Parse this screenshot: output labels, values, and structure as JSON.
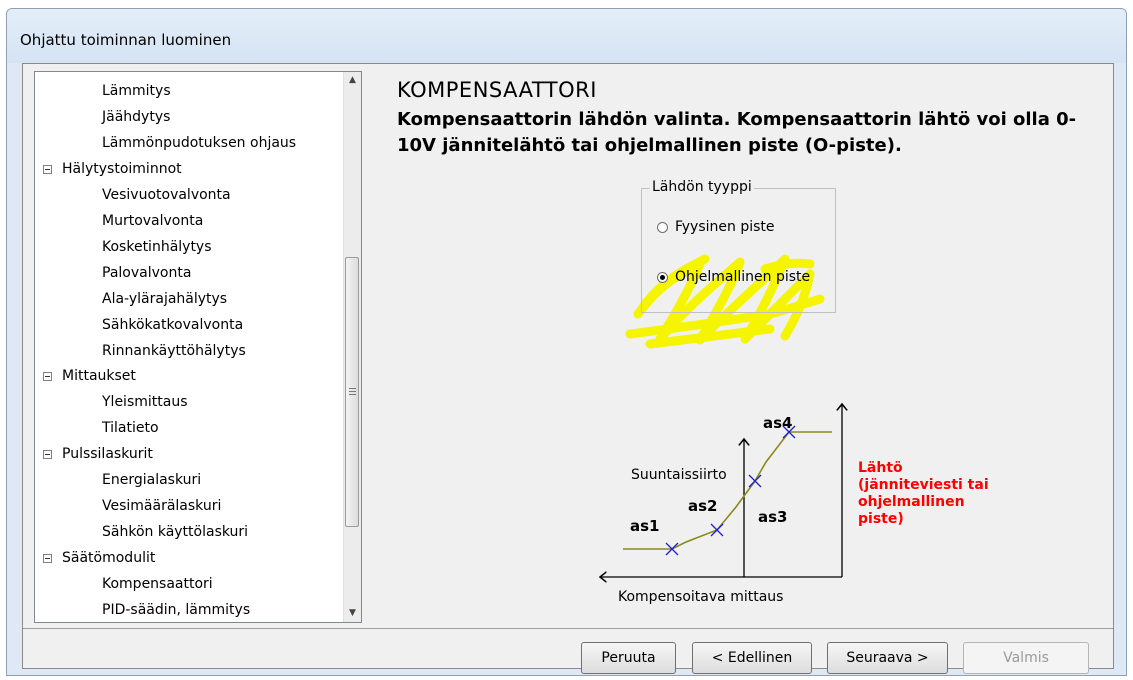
{
  "window": {
    "title": "Ohjattu toiminnan luominen"
  },
  "tree": {
    "items": [
      {
        "label": "Lämmitys",
        "level": 1
      },
      {
        "label": "Jäähdytys",
        "level": 1
      },
      {
        "label": "Lämmönpudotuksen ohjaus",
        "level": 1
      },
      {
        "label": "Hälytystoiminnot",
        "level": 0,
        "expanded": true
      },
      {
        "label": "Vesivuotovalvonta",
        "level": 1
      },
      {
        "label": "Murtovalvonta",
        "level": 1
      },
      {
        "label": "Kosketinhälytys",
        "level": 1
      },
      {
        "label": "Palovalvonta",
        "level": 1
      },
      {
        "label": "Ala-ylärajahälytys",
        "level": 1
      },
      {
        "label": "Sähkökatkovalvonta",
        "level": 1
      },
      {
        "label": "Rinnankäyttöhälytys",
        "level": 1
      },
      {
        "label": "Mittaukset",
        "level": 0,
        "expanded": true
      },
      {
        "label": "Yleismittaus",
        "level": 1
      },
      {
        "label": "Tilatieto",
        "level": 1
      },
      {
        "label": "Pulssilaskurit",
        "level": 0,
        "expanded": true
      },
      {
        "label": "Energialaskuri",
        "level": 1
      },
      {
        "label": "Vesimäärälaskuri",
        "level": 1
      },
      {
        "label": "Sähkön käyttölaskuri",
        "level": 1
      },
      {
        "label": "Säätömodulit",
        "level": 0,
        "expanded": true
      },
      {
        "label": "Kompensaattori",
        "level": 1
      },
      {
        "label": "PID-säädin, lämmitys",
        "level": 1
      }
    ]
  },
  "panel": {
    "title": "KOMPENSAATTORI",
    "description": "Kompensaattorin lähdön valinta. Kompensaattorin lähtö voi olla 0-10V jännitelähtö tai ohjelmallinen piste (O-piste).",
    "group": {
      "label": "Lähdön tyyppi",
      "options": [
        {
          "label": "Fyysinen piste",
          "selected": false
        },
        {
          "label": "Ohjelmallinen piste",
          "selected": true
        }
      ]
    },
    "highlight_color": "#f5f500"
  },
  "diagram": {
    "labels": {
      "shift": "Suuntaissiirto",
      "input": "Kompensoitava mittaus",
      "output_lines": [
        "Lähtö",
        "(jänniteviesti tai",
        "ohjelmallinen",
        "piste)"
      ],
      "points": [
        "as1",
        "as2",
        "as3",
        "as4"
      ]
    },
    "colors": {
      "curve": "#8a8a1a",
      "marker": "#2020d0",
      "output": "#ff0000"
    }
  },
  "buttons": {
    "cancel": "Peruuta",
    "back": "< Edellinen",
    "next": "Seuraava >",
    "finish": "Valmis"
  }
}
